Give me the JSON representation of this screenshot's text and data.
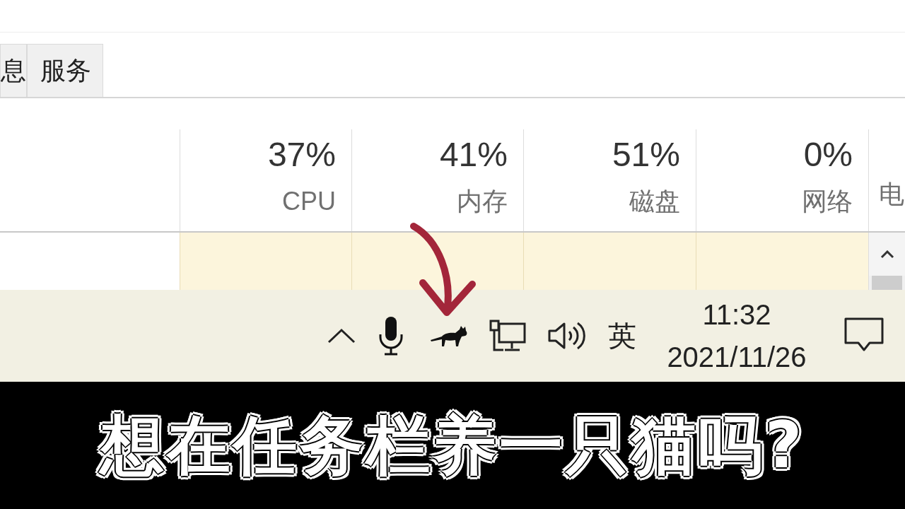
{
  "tabs": [
    {
      "label": "息",
      "selected": false
    },
    {
      "label": "服务",
      "selected": false
    }
  ],
  "columns": [
    {
      "value": "37%",
      "label": "CPU"
    },
    {
      "value": "41%",
      "label": "内存"
    },
    {
      "value": "51%",
      "label": "磁盘"
    },
    {
      "value": "0%",
      "label": "网络"
    },
    {
      "label": "电"
    }
  ],
  "taskbar": {
    "input_method": "英",
    "time": "11:32",
    "date": "2021/11/26"
  },
  "caption": "想在任务栏养一只猫吗?"
}
